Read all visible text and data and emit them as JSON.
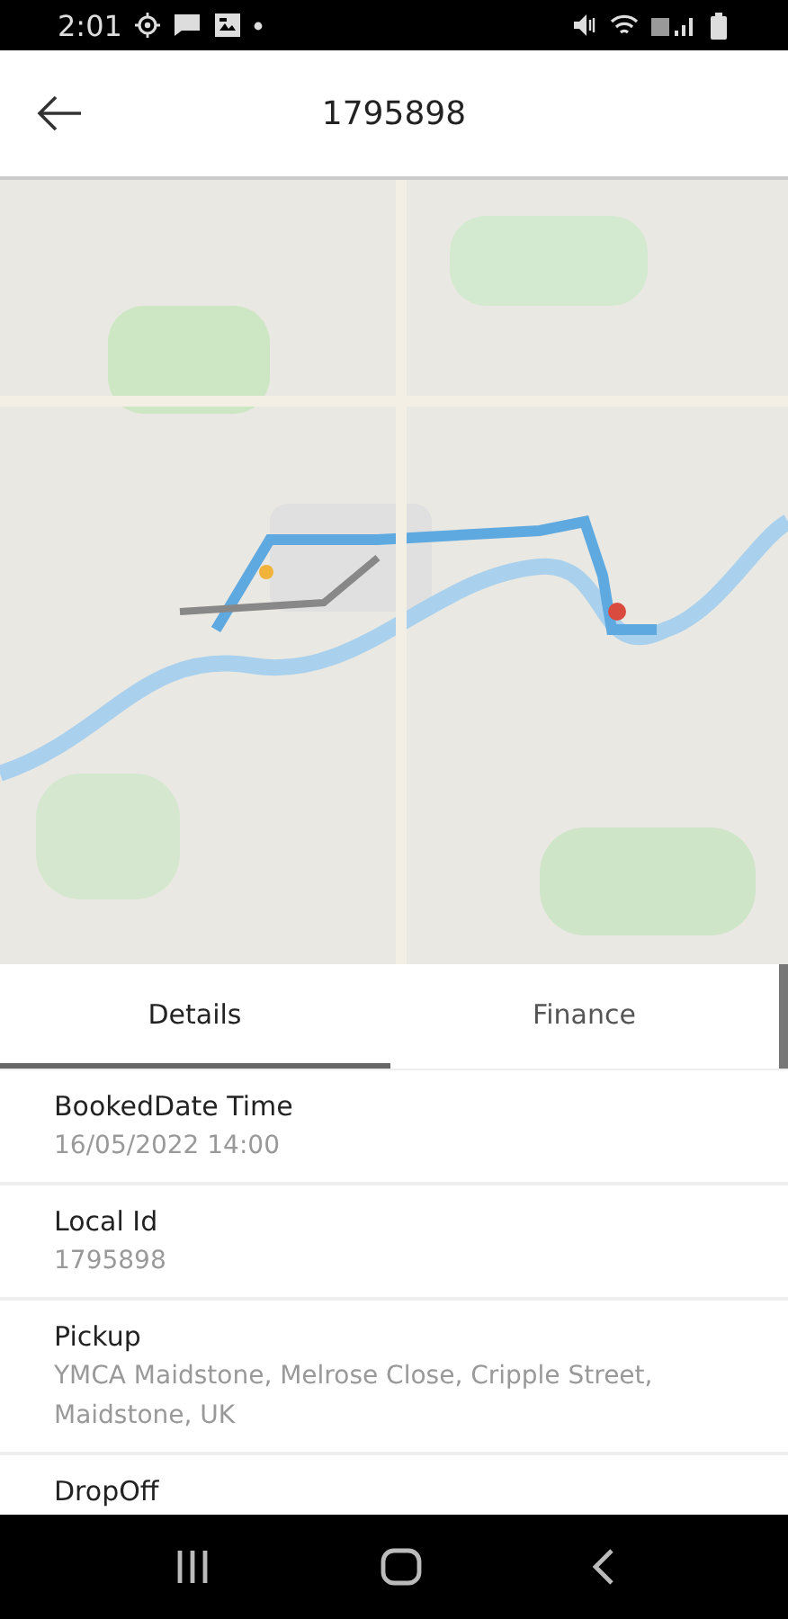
{
  "status_bar": {
    "time": "2:01"
  },
  "header": {
    "title": "1795898"
  },
  "tabs": [
    {
      "label": "Details",
      "selected": true
    },
    {
      "label": "Finance",
      "selected": false
    }
  ],
  "details": [
    {
      "label": "BookedDate Time",
      "value": "16/05/2022 14:00"
    },
    {
      "label": "Local Id",
      "value": "1795898"
    },
    {
      "label": "Pickup",
      "value": "YMCA Maidstone, Melrose Close, Cripple Street, Maidstone, UK"
    },
    {
      "label": "DropOff"
    }
  ]
}
